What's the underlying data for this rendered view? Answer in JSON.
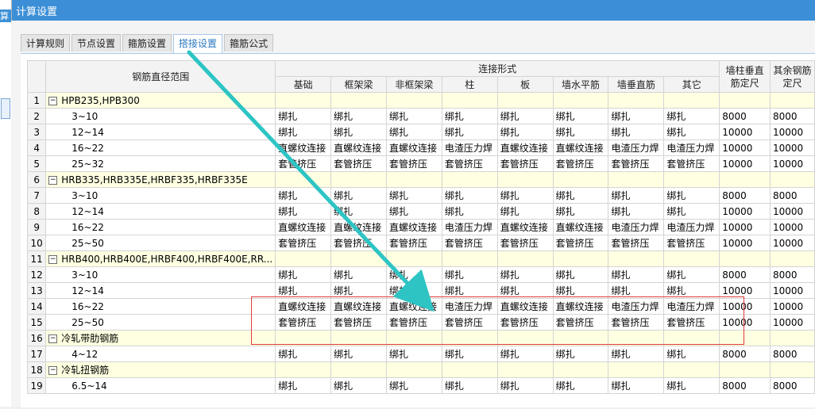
{
  "window": {
    "title": "计算设置",
    "left_fragment": "算"
  },
  "tabs": [
    {
      "label": "计算规则",
      "active": false
    },
    {
      "label": "节点设置",
      "active": false
    },
    {
      "label": "箍筋设置",
      "active": false
    },
    {
      "label": "搭接设置",
      "active": true
    },
    {
      "label": "箍筋公式",
      "active": false
    }
  ],
  "table": {
    "header_range": "钢筋直径范围",
    "header_group": "连接形式",
    "header_cols": [
      "基础",
      "框架梁",
      "非框架梁",
      "柱",
      "板",
      "墙水平筋",
      "墙垂直筋",
      "其它"
    ],
    "header_extra": [
      "墙柱垂直筋定尺",
      "其余钢筋定尺"
    ],
    "rows": [
      {
        "num": "1",
        "group": true,
        "label": "HPB235,HPB300"
      },
      {
        "num": "2",
        "label": "3~10",
        "cells": [
          "绑扎",
          "绑扎",
          "绑扎",
          "绑扎",
          "绑扎",
          "绑扎",
          "绑扎",
          "绑扎",
          "8000",
          "8000"
        ]
      },
      {
        "num": "3",
        "label": "12~14",
        "cells": [
          "绑扎",
          "绑扎",
          "绑扎",
          "绑扎",
          "绑扎",
          "绑扎",
          "绑扎",
          "绑扎",
          "10000",
          "10000"
        ]
      },
      {
        "num": "4",
        "label": "16~22",
        "cells": [
          "直螺纹连接",
          "直螺纹连接",
          "直螺纹连接",
          "电渣压力焊",
          "直螺纹连接",
          "直螺纹连接",
          "电渣压力焊",
          "电渣压力焊",
          "10000",
          "10000"
        ]
      },
      {
        "num": "5",
        "label": "25~32",
        "cells": [
          "套管挤压",
          "套管挤压",
          "套管挤压",
          "套管挤压",
          "套管挤压",
          "套管挤压",
          "套管挤压",
          "套管挤压",
          "10000",
          "10000"
        ]
      },
      {
        "num": "6",
        "group": true,
        "label": "HRB335,HRB335E,HRBF335,HRBF335E"
      },
      {
        "num": "7",
        "label": "3~10",
        "cells": [
          "绑扎",
          "绑扎",
          "绑扎",
          "绑扎",
          "绑扎",
          "绑扎",
          "绑扎",
          "绑扎",
          "8000",
          "8000"
        ]
      },
      {
        "num": "8",
        "label": "12~14",
        "cells": [
          "绑扎",
          "绑扎",
          "绑扎",
          "绑扎",
          "绑扎",
          "绑扎",
          "绑扎",
          "绑扎",
          "10000",
          "10000"
        ]
      },
      {
        "num": "9",
        "label": "16~22",
        "cells": [
          "直螺纹连接",
          "直螺纹连接",
          "直螺纹连接",
          "电渣压力焊",
          "直螺纹连接",
          "直螺纹连接",
          "电渣压力焊",
          "电渣压力焊",
          "10000",
          "10000"
        ]
      },
      {
        "num": "10",
        "label": "25~50",
        "cells": [
          "套管挤压",
          "套管挤压",
          "套管挤压",
          "套管挤压",
          "套管挤压",
          "套管挤压",
          "套管挤压",
          "套管挤压",
          "10000",
          "10000"
        ]
      },
      {
        "num": "11",
        "group": true,
        "label": "HRB400,HRB400E,HRBF400,HRBF400E,RR..."
      },
      {
        "num": "12",
        "label": "3~10",
        "cells": [
          "绑扎",
          "绑扎",
          "绑扎",
          "绑扎",
          "绑扎",
          "绑扎",
          "绑扎",
          "绑扎",
          "8000",
          "8000"
        ]
      },
      {
        "num": "13",
        "label": "12~14",
        "cells": [
          "绑扎",
          "绑扎",
          "绑扎",
          "绑扎",
          "绑扎",
          "绑扎",
          "绑扎",
          "绑扎",
          "10000",
          "10000"
        ]
      },
      {
        "num": "14",
        "label": "16~22",
        "cells": [
          "直螺纹连接",
          "直螺纹连接",
          "直螺纹连接",
          "电渣压力焊",
          "直螺纹连接",
          "直螺纹连接",
          "电渣压力焊",
          "电渣压力焊",
          "10000",
          "10000"
        ]
      },
      {
        "num": "15",
        "label": "25~50",
        "cells": [
          "套管挤压",
          "套管挤压",
          "套管挤压",
          "套管挤压",
          "套管挤压",
          "套管挤压",
          "套管挤压",
          "套管挤压",
          "10000",
          "10000"
        ]
      },
      {
        "num": "16",
        "group": true,
        "label": "冷轧带肋钢筋"
      },
      {
        "num": "17",
        "label": "4~12",
        "cells": [
          "绑扎",
          "绑扎",
          "绑扎",
          "绑扎",
          "绑扎",
          "绑扎",
          "绑扎",
          "绑扎",
          "8000",
          "8000"
        ]
      },
      {
        "num": "18",
        "group": true,
        "label": "冷轧扭钢筋"
      },
      {
        "num": "19",
        "label": "6.5~14",
        "cells": [
          "绑扎",
          "绑扎",
          "绑扎",
          "绑扎",
          "绑扎",
          "绑扎",
          "绑扎",
          "绑扎",
          "8000",
          "8000"
        ]
      }
    ]
  },
  "colors": {
    "titlebar": "#3c8fd6",
    "group_row": "#ffffe1",
    "highlight": "#e03b3b",
    "arrow": "#2ec4c4"
  },
  "collapse_glyph": "−"
}
